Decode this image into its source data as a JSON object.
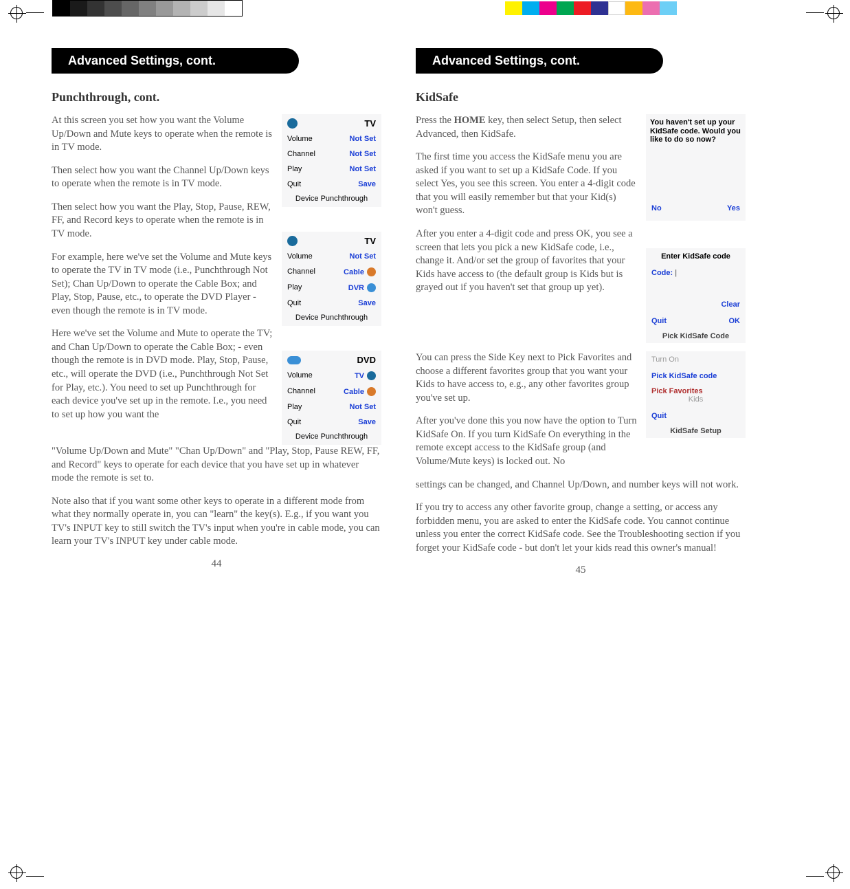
{
  "registration": {
    "gray_swatches": [
      "#000",
      "#1a1a1a",
      "#333",
      "#4d4d4d",
      "#666",
      "#808080",
      "#999",
      "#b3b3b3",
      "#ccc",
      "#e6e6e6",
      "#fff"
    ],
    "color_swatches": [
      "#fff200",
      "#00aeef",
      "#ec008c",
      "#00a651",
      "#ed1c24",
      "#2e3192",
      "#fff",
      "#fdb913",
      "#ec6eb0",
      "#6dcff6",
      "#fff"
    ]
  },
  "pages": {
    "left": {
      "badge": "Advanced Settings, cont.",
      "heading": "Punchthrough, cont.",
      "paras": [
        "At this screen you set how you want the Volume Up/Down and Mute keys to operate when the remote is in TV mode.",
        "Then select how you want the Channel Up/Down keys to operate when the remote is in TV mode.",
        "Then select how you want the Play, Stop, Pause, REW, FF, and Record keys to operate when the remote is in TV mode.",
        "For example, here we've set the Volume and Mute keys to operate the TV in TV mode (i.e., Punchthrough Not Set); Chan Up/Down to operate the Cable Box; and Play, Stop, Pause, etc., to operate the DVD Player - even though the remote is in TV mode.",
        "Here we've set the Volume and Mute to operate the TV; and Chan Up/Down to operate the Cable Box; - even though the remote is in DVD mode. Play, Stop, Pause, etc., will operate the DVD (i.e., Punchthrough Not Set for Play, etc.). You need to set up Punchthrough for each device you've set up in the remote. I.e., you need to set up how you want the",
        "\"Volume Up/Down and Mute\" \"Chan Up/Down\" and \"Play, Stop, Pause REW, FF, and Record\" keys to operate for each device that you have set up in whatever mode the remote is set to.",
        "Note also that if you want some other keys to operate in a different mode from what they normally operate in, you can \"learn\" the key(s). E.g., if you want you TV's INPUT key to still switch the TV's input when you're in cable mode, you can learn your TV's INPUT key under cable mode."
      ],
      "pagenum": "44",
      "shots": {
        "a": {
          "title": "TV",
          "rows": [
            {
              "label": "Volume",
              "value": "Not Set"
            },
            {
              "label": "Channel",
              "value": "Not Set"
            },
            {
              "label": "Play",
              "value": "Not Set"
            },
            {
              "label": "Quit",
              "value": "Save"
            }
          ],
          "footer": "Device Punchthrough"
        },
        "b": {
          "title": "TV",
          "rows": [
            {
              "label": "Volume",
              "value": "Not Set"
            },
            {
              "label": "Channel",
              "value": "Cable",
              "icon": "#d97a2a"
            },
            {
              "label": "Play",
              "value": "DVR",
              "icon": "#3a8fd6"
            },
            {
              "label": "Quit",
              "value": "Save"
            }
          ],
          "footer": "Device Punchthrough"
        },
        "c": {
          "title": "DVD",
          "rows": [
            {
              "label": "Volume",
              "value": "TV",
              "icon": "#1a6b9c"
            },
            {
              "label": "Channel",
              "value": "Cable",
              "icon": "#d97a2a"
            },
            {
              "label": "Play",
              "value": "Not Set"
            },
            {
              "label": "Quit",
              "value": "Save"
            }
          ],
          "footer": "Device Punchthrough"
        }
      }
    },
    "right": {
      "badge": "Advanced Settings, cont.",
      "heading": "KidSafe",
      "paras1": [
        "Press the HOME key, then select Setup, then select Advanced, then KidSafe.",
        "The first time you access the KidSafe menu you are asked if you want to set up a KidSafe Code. If you select Yes, you see this screen. You enter a 4-digit code that you will easily remember but that your Kid(s) won't guess.",
        "After you enter a 4-digit code and press OK, you see a screen that lets you pick a new KidSafe code, i.e., change it. And/or set the group of favorites that your Kids have access to (the default group is Kids but is grayed out if you haven't set that group up yet)."
      ],
      "paras2": [
        "You can press the Side Key next to Pick Favorites and choose a different favorites group that you want your Kids to have access to, e.g., any other favorites group you've set up.",
        "After you've done this you now have the option to Turn KidSafe On. If you turn KidSafe On everything in the remote except access to the KidSafe group (and Volume/Mute keys) is locked out. No",
        "settings can be changed, and Channel Up/Down, and number keys will not work.",
        "If you try to access any other favorite group, change a setting, or access any forbidden menu, you are asked to enter the KidSafe code. You cannot continue unless you enter the correct KidSafe code. See the Troubleshooting section if you forget your KidSafe code - but don't let your kids read this owner's manual!"
      ],
      "pagenum": "45",
      "kshots": {
        "a": {
          "msg": "You haven't set up your KidSafe code. Would you like to do so now?",
          "no": "No",
          "yes": "Yes"
        },
        "b": {
          "header": "Enter KidSafe code",
          "code_label": "Code:",
          "clear": "Clear",
          "quit": "Quit",
          "ok": "OK",
          "footer": "Pick KidSafe Code"
        },
        "c": {
          "turn_on": "Turn On",
          "pick_code": "Pick KidSafe code",
          "pick_fav": "Pick Favorites",
          "kids": "Kids",
          "quit": "Quit",
          "footer": "KidSafe Setup"
        }
      }
    }
  }
}
